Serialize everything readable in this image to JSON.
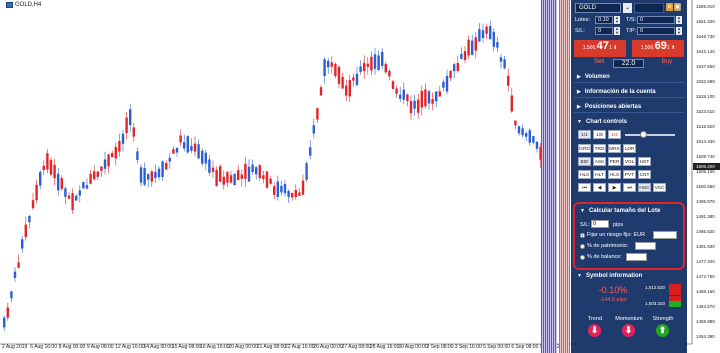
{
  "chart": {
    "title": "GOLD,H4",
    "x_labels": [
      "2 Aug 2019",
      "6 Aug 16:00",
      "8 Aug 00:00",
      "9 Aug 08:00",
      "12 Aug 16:00",
      "14 Aug 00:00",
      "15 Aug 08:00",
      "16 Aug 16:00",
      "20 Aug 00:00",
      "21 Aug 08:00",
      "22 Aug 16:00",
      "26 Aug 00:00",
      "27 Aug 08:00",
      "28 Aug 16:00",
      "30 Aug 00:00",
      "2 Sep 08:00",
      "3 Sep 16:00",
      "5 Sep 00:00",
      "6 Sep 08:00",
      "9 Sep 12:00"
    ],
    "y_labels": [
      "1555.910",
      "1551.320",
      "1546.730",
      "1542.140",
      "1537.550",
      "1532.690",
      "1528.100",
      "1523.510",
      "1518.920",
      "1514.330",
      "1509.740",
      "1505.150",
      "1500.560",
      "1495.970",
      "1491.380",
      "1486.520",
      "1481.930",
      "1477.340",
      "1472.750",
      "1468.160",
      "1463.570",
      "1458.980",
      "1454.390"
    ],
    "current_price": "1506.409"
  },
  "panel": {
    "symbol": "GOLD",
    "lots_label": "Lotes:",
    "lots_value": "0.10",
    "sl_label": "S/L:",
    "sl_value": "0",
    "ts_label": "T/S:",
    "ts_value": "0",
    "tp_label": "T/P:",
    "tp_value": "0",
    "sell_price_prefix": "1,506.",
    "sell_price_big": "47",
    "sell_price_suffix": "1",
    "buy_price_prefix": "1,506.",
    "buy_price_big": "69",
    "buy_price_suffix": "1",
    "sell_label": "Sell",
    "buy_label": "Buy",
    "lot_display": "22.0",
    "sections": {
      "volumen": "Volumen",
      "info": "Información de la cuenta",
      "positions": "Posiciones abiertas",
      "chart_controls": "Chart controls",
      "calc": "Calcular tamaño del Lote",
      "symbol_info": "Symbol information"
    },
    "zoom": [
      "1/1",
      "1/8",
      "1/4"
    ],
    "row_buttons_1": [
      "GRD",
      "TRD",
      "MRK",
      "LDR"
    ],
    "row_buttons_2": [
      "BID",
      "ASK",
      "PER",
      "VOL",
      "HST"
    ],
    "row_buttons_3": [
      "HL0",
      "HLT",
      "HLS",
      "PVT",
      "CNT"
    ],
    "row_buttons_4": [
      "⏮",
      "◀",
      "▶",
      "⏭",
      "HSC",
      "VSC"
    ],
    "calc": {
      "sl_label": "S/L:",
      "sl_value": "0",
      "pips_label": "pips",
      "opt1": "Fijar un riesgo fijo: EUR",
      "opt2": "% de patrimonio:",
      "opt3": "% de balance:"
    },
    "symbol_info": {
      "change_pct": "-0.10%",
      "change_pips": "-144.0 pips",
      "high": "1,512.520",
      "low": "1,503.320",
      "trend_label": "Trend",
      "momentum_label": "Momentum",
      "strength_label": "Strength"
    },
    "colors": {
      "panel_bg": "#1f3b6e",
      "sell": "#d83b2c",
      "buy": "#d83b2c",
      "calc_border": "#e0242a",
      "down_arrow": "#e0245a",
      "up_arrow": "#1fa81f"
    }
  }
}
